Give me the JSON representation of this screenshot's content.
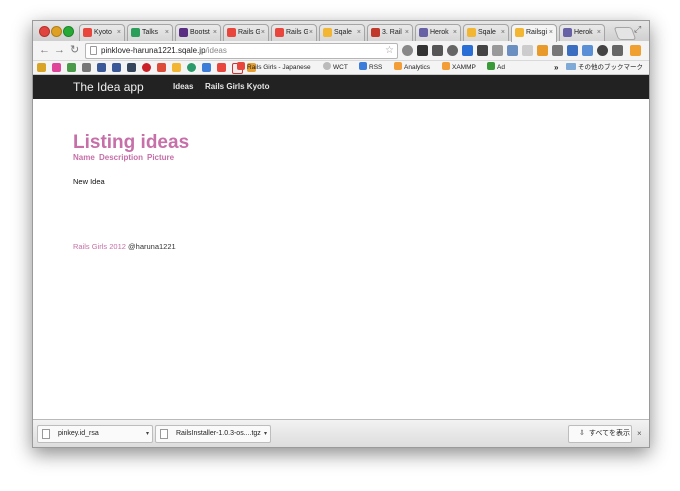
{
  "browser": {
    "tabs": [
      {
        "label": "Kyoto",
        "color": "#e8453c",
        "active": false
      },
      {
        "label": "Talks",
        "color": "#2b9e5a",
        "active": false
      },
      {
        "label": "Bootst",
        "color": "#5a2d82",
        "active": false
      },
      {
        "label": "Rails G",
        "color": "#e8453c",
        "active": false
      },
      {
        "label": "Rails G",
        "color": "#e8453c",
        "active": false
      },
      {
        "label": "Sqale",
        "color": "#f2b632",
        "active": false
      },
      {
        "label": "3. Rail",
        "color": "#c0392b",
        "active": false
      },
      {
        "label": "Herok",
        "color": "#6762a6",
        "active": false
      },
      {
        "label": "Sqale",
        "color": "#f2b632",
        "active": false
      },
      {
        "label": "Railsgi",
        "color": "#f2b632",
        "active": true
      },
      {
        "label": "Herok",
        "color": "#6762a6",
        "active": false
      }
    ],
    "url_host": "pinklove-haruna1221.sqale.jp",
    "url_path": "/ideas",
    "bookmarks": [
      {
        "label": "Rails Girls - Japanese",
        "color": "#e8453c"
      },
      {
        "label": "WCT",
        "color": "#999999"
      },
      {
        "label": "RSS",
        "color": "#3b7dd8"
      },
      {
        "label": "Analytics",
        "color": "#f29d38"
      },
      {
        "label": "XAMMP",
        "color": "#f29d38"
      },
      {
        "label": "Ad",
        "color": "#3a9a3a"
      }
    ],
    "bookmarks_more": "»",
    "other_bookmarks": "その他のブックマーク"
  },
  "page": {
    "brand": "The Idea app",
    "nav": [
      "Ideas",
      "Rails Girls Kyoto"
    ],
    "heading": "Listing ideas",
    "columns": [
      "Name",
      "Description",
      "Picture"
    ],
    "new_link": "New Idea",
    "footer_link": "Rails Girls 2012",
    "footer_author": "@haruna1221"
  },
  "downloads": {
    "items": [
      "pinkey.id_rsa",
      "RailsInstaller-1.0.3-os....tgz"
    ],
    "show_all": "すべてを表示"
  },
  "colors": {
    "accent": "#c66fa8",
    "navbar": "#222222"
  }
}
